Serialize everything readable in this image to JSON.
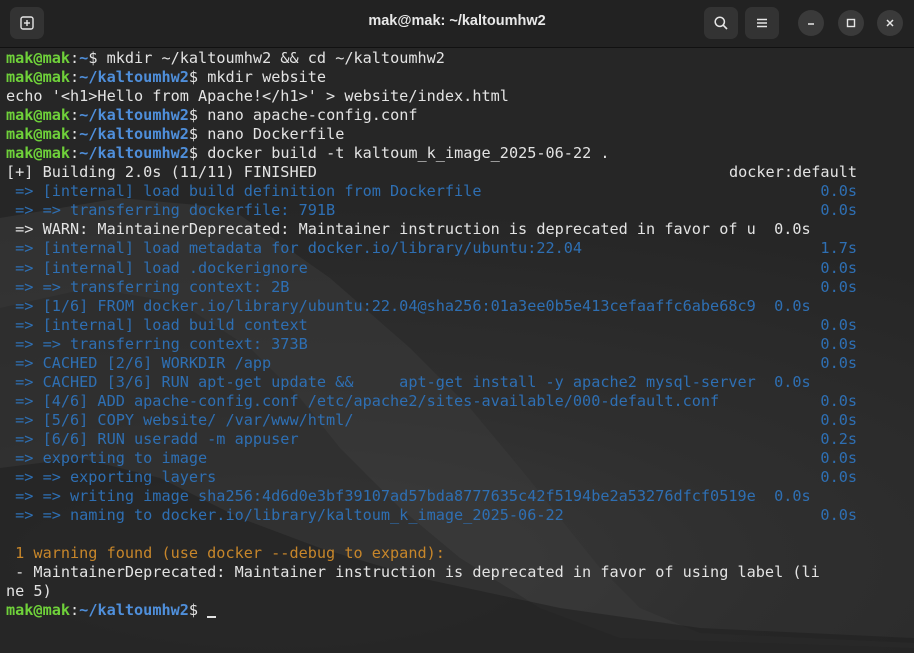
{
  "window": {
    "title": "mak@mak: ~/kaltoumhw2",
    "icons": {
      "new_tab": "new-tab-icon",
      "search": "search-icon",
      "menu": "hamburger-menu-icon",
      "minimize": "minimize-icon",
      "maximize": "maximize-icon",
      "close": "close-icon"
    }
  },
  "colors": {
    "prompt_user": "#6fd13a",
    "prompt_path": "#4f8fdb",
    "build_step": "#2e6fb3",
    "warning": "#c7862a",
    "text": "#e3e3e3"
  },
  "terminal": {
    "prompt_user": "mak@mak",
    "prompt_sep": ":",
    "prompt_dollar": "$ ",
    "lines": [
      {
        "kind": "prompt",
        "path": "~",
        "cmd": "mkdir ~/kaltoumhw2 && cd ~/kaltoumhw2"
      },
      {
        "kind": "prompt",
        "path": "~/kaltoumhw2",
        "cmd": "mkdir website"
      },
      {
        "kind": "plain",
        "text": "echo '<h1>Hello from Apache!</h1>' > website/index.html"
      },
      {
        "kind": "prompt",
        "path": "~/kaltoumhw2",
        "cmd": "nano apache-config.conf"
      },
      {
        "kind": "prompt",
        "path": "~/kaltoumhw2",
        "cmd": "nano Dockerfile"
      },
      {
        "kind": "prompt",
        "path": "~/kaltoumhw2",
        "cmd": "docker build -t kaltoum_k_image_2025-06-22 ."
      },
      {
        "kind": "header",
        "text": "[+] Building 2.0s (11/11) FINISHED",
        "right": "docker:default"
      },
      {
        "kind": "blue",
        "text": " => [internal] load build definition from Dockerfile",
        "right": "0.0s"
      },
      {
        "kind": "blue",
        "text": " => => transferring dockerfile: 791B",
        "right": "0.0s"
      },
      {
        "kind": "plain",
        "text": " => WARN: MaintainerDeprecated: Maintainer instruction is deprecated in favor of u  0.0s"
      },
      {
        "kind": "blue",
        "text": " => [internal] load metadata for docker.io/library/ubuntu:22.04",
        "right": "1.7s"
      },
      {
        "kind": "blue",
        "text": " => [internal] load .dockerignore",
        "right": "0.0s"
      },
      {
        "kind": "blue",
        "text": " => => transferring context: 2B",
        "right": "0.0s"
      },
      {
        "kind": "blue",
        "text": " => [1/6] FROM docker.io/library/ubuntu:22.04@sha256:01a3ee0b5e413cefaaffc6abe68c9  0.0s"
      },
      {
        "kind": "blue",
        "text": " => [internal] load build context",
        "right": "0.0s"
      },
      {
        "kind": "blue",
        "text": " => => transferring context: 373B",
        "right": "0.0s"
      },
      {
        "kind": "blue",
        "text": " => CACHED [2/6] WORKDIR /app",
        "right": "0.0s"
      },
      {
        "kind": "blue",
        "text": " => CACHED [3/6] RUN apt-get update &&     apt-get install -y apache2 mysql-server  0.0s"
      },
      {
        "kind": "blue",
        "text": " => [4/6] ADD apache-config.conf /etc/apache2/sites-available/000-default.conf",
        "right": "0.0s"
      },
      {
        "kind": "blue",
        "text": " => [5/6] COPY website/ /var/www/html/",
        "right": "0.0s"
      },
      {
        "kind": "blue",
        "text": " => [6/6] RUN useradd -m appuser",
        "right": "0.2s"
      },
      {
        "kind": "blue",
        "text": " => exporting to image",
        "right": "0.0s"
      },
      {
        "kind": "blue",
        "text": " => => exporting layers",
        "right": "0.0s"
      },
      {
        "kind": "blue",
        "text": " => => writing image sha256:4d6d0e3bf39107ad57bda8777635c42f5194be2a53276dfcf0519e  0.0s"
      },
      {
        "kind": "blue",
        "text": " => => naming to docker.io/library/kaltoum_k_image_2025-06-22",
        "right": "0.0s"
      },
      {
        "kind": "empty",
        "text": ""
      },
      {
        "kind": "warn",
        "text": " 1 warning found (use docker --debug to expand):"
      },
      {
        "kind": "plain",
        "text": " - MaintainerDeprecated: Maintainer instruction is deprecated in favor of using label (li"
      },
      {
        "kind": "plain",
        "text": "ne 5)"
      },
      {
        "kind": "prompt_cursor",
        "path": "~/kaltoumhw2",
        "cmd": ""
      }
    ]
  }
}
